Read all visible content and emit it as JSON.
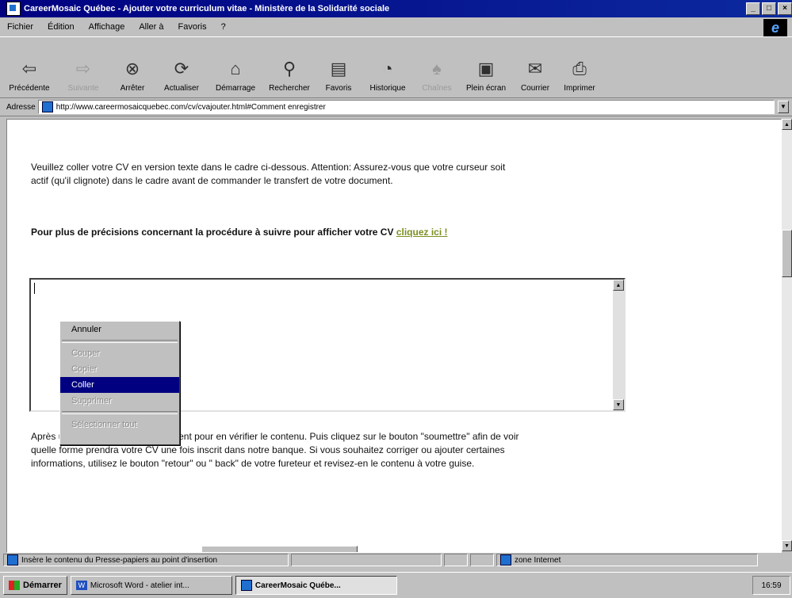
{
  "window": {
    "title": "CareerMosaic Québec - Ajouter votre curriculum vitae - Ministère de la Solidarité sociale"
  },
  "menubar": {
    "items": [
      "Fichier",
      "Édition",
      "Affichage",
      "Aller à",
      "Favoris",
      "?"
    ]
  },
  "toolbar": {
    "buttons": [
      {
        "label": "Précédente",
        "icon": "back-arrow-icon",
        "enabled": true
      },
      {
        "label": "Suivante",
        "icon": "forward-arrow-icon",
        "enabled": false
      },
      {
        "label": "Arrêter",
        "icon": "stop-icon",
        "enabled": true
      },
      {
        "label": "Actualiser",
        "icon": "refresh-icon",
        "enabled": true
      },
      {
        "label": "Démarrage",
        "icon": "home-icon",
        "enabled": true
      },
      {
        "label": "Rechercher",
        "icon": "search-icon",
        "enabled": true
      },
      {
        "label": "Favoris",
        "icon": "favorites-icon",
        "enabled": true
      },
      {
        "label": "Historique",
        "icon": "history-icon",
        "enabled": true
      },
      {
        "label": "Chaînes",
        "icon": "channels-icon",
        "enabled": false
      },
      {
        "label": "Plein écran",
        "icon": "fullscreen-icon",
        "enabled": true
      },
      {
        "label": "Courrier",
        "icon": "mail-icon",
        "enabled": true
      },
      {
        "label": "Imprimer",
        "icon": "print-icon",
        "enabled": true
      }
    ]
  },
  "address": {
    "label": "Adresse",
    "url": "http://www.careermosaicquebec.com/cv/cvajouter.html#Comment enregistrer"
  },
  "content": {
    "para1": "Veuillez coller votre CV en version texte dans le cadre ci-dessous. Attention: Assurez-vous que votre curseur soit actif (qu'il clignote) dans le cadre avant de commander le transfert de votre document.",
    "para2_text": "Pour plus de précisions concernant la procédure à suivre pour afficher votre CV",
    "para2_link": "cliquez ici !",
    "para3_before": "Après",
    "para3_rest": " utilisez les barres de défilement pour en vérifier le contenu. Puis cliquez sur le bouton \"soumettre\" afin de voir quelle forme prendra votre CV une fois inscrit dans notre banque. Si vous souhaitez corriger ou ajouter certaines informations, utilisez le bouton \"retour\" ou \" back\" de votre fureteur et revisez-en le contenu à votre guise."
  },
  "context_menu": {
    "items": [
      {
        "label": "Annuler",
        "enabled": true
      },
      {
        "label": "Couper",
        "enabled": false
      },
      {
        "label": "Copier",
        "enabled": false
      },
      {
        "label": "Coller",
        "enabled": true,
        "selected": true
      },
      {
        "label": "Supprimer",
        "enabled": false
      },
      {
        "label": "Sélectionner tout",
        "enabled": false
      }
    ]
  },
  "statusbar": {
    "message": "Insère le contenu du Presse-papiers au point d'insertion",
    "zone": "zone Internet"
  },
  "taskbar": {
    "start": "Démarrer",
    "tasks": [
      {
        "label": "Microsoft Word - atelier int...",
        "active": false
      },
      {
        "label": "CareerMosaic Québe...",
        "active": true
      }
    ],
    "clock": "16:59"
  }
}
